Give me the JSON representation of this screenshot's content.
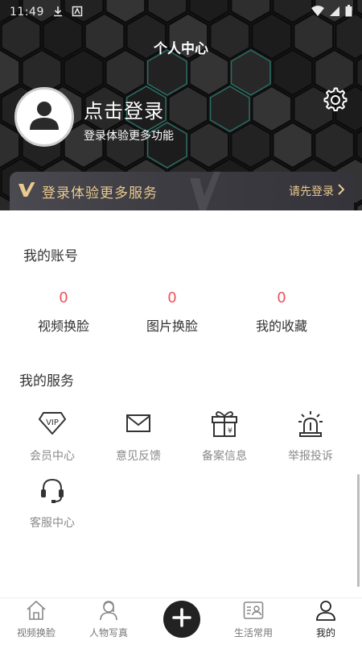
{
  "status_bar": {
    "time": "11:49"
  },
  "header": {
    "title": "个人中心",
    "login_title": "点击登录",
    "login_subtitle": "登录体验更多功能"
  },
  "vip_banner": {
    "text": "登录体验更多服务",
    "action": "请先登录"
  },
  "account": {
    "title": "我的账号",
    "stats": [
      {
        "value": "0",
        "label": "视频换脸"
      },
      {
        "value": "0",
        "label": "图片换脸"
      },
      {
        "value": "0",
        "label": "我的收藏"
      }
    ]
  },
  "services": {
    "title": "我的服务",
    "items": [
      {
        "label": "会员中心",
        "icon": "vip-icon"
      },
      {
        "label": "意见反馈",
        "icon": "mail-icon"
      },
      {
        "label": "备案信息",
        "icon": "gift-icon"
      },
      {
        "label": "举报投诉",
        "icon": "alarm-icon"
      },
      {
        "label": "客服中心",
        "icon": "headset-icon"
      }
    ],
    "vip_badge_text": "VIP"
  },
  "bottom_nav": {
    "items": [
      {
        "label": "视频换脸",
        "icon": "home-icon",
        "active": false
      },
      {
        "label": "人物写真",
        "icon": "portrait-icon",
        "active": false
      },
      {
        "label": "生活常用",
        "icon": "contact-card-icon",
        "active": false
      },
      {
        "label": "我的",
        "icon": "person-icon",
        "active": true
      }
    ],
    "add_icon": "plus-icon"
  },
  "colors": {
    "header_bg": "#151515",
    "accent_gold": "#e9c98f",
    "stat_red": "#f0505c",
    "banner_bg": "#3c3c42"
  }
}
